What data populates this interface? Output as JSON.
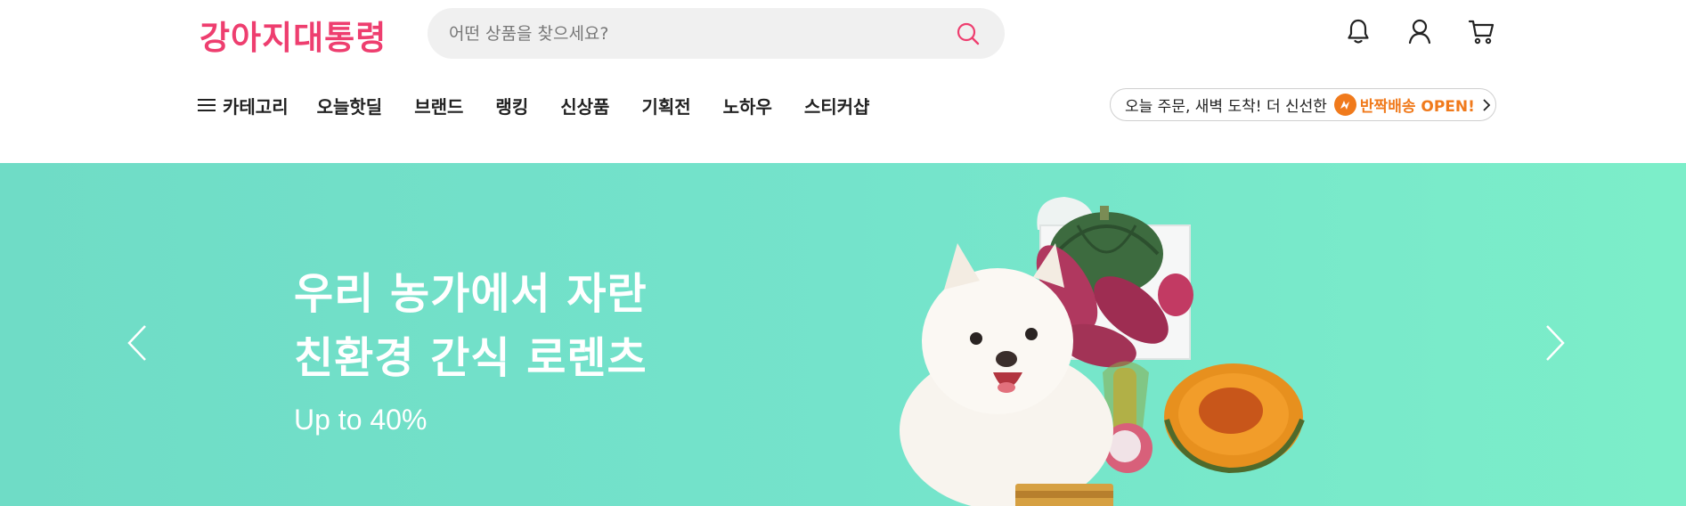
{
  "header": {
    "logo_text": "강아지대통령",
    "search": {
      "placeholder": "어떤 상품을 찾으세요?"
    },
    "icons": [
      "bell-icon",
      "user-icon",
      "cart-icon"
    ]
  },
  "nav": {
    "category_label": "카테고리",
    "items": [
      {
        "label": "오늘핫딜"
      },
      {
        "label": "브랜드"
      },
      {
        "label": "랭킹"
      },
      {
        "label": "신상품"
      },
      {
        "label": "기획전"
      },
      {
        "label": "노하우"
      },
      {
        "label": "스티커샵"
      }
    ]
  },
  "promo": {
    "text": "오늘 주문, 새벽 도착! 더 신선한",
    "brand": "반짝배송 OPEN!"
  },
  "banner": {
    "title_line1": "우리 농가에서 자란",
    "title_line2": "친환경 간식 로렌츠",
    "subtitle": "Up to 40%",
    "background_colors": [
      "#6fdcc6",
      "#7ceec9"
    ]
  },
  "colors": {
    "brand_pink": "#ee3e6f",
    "accent_orange": "#f07a1c"
  }
}
